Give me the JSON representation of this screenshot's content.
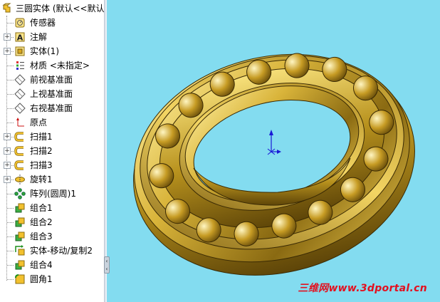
{
  "tree": {
    "root": {
      "label": "三圆实体 (默认<<默认",
      "icon": "part-icon"
    },
    "items": [
      {
        "label": "传感器",
        "icon": "sensor-icon",
        "expandable": false
      },
      {
        "label": "注解",
        "icon": "annotation-icon",
        "expandable": true
      },
      {
        "label": "实体(1)",
        "icon": "solid-bodies-icon",
        "expandable": true
      },
      {
        "label": "材质 <未指定>",
        "icon": "material-icon",
        "expandable": false
      },
      {
        "label": "前视基准面",
        "icon": "plane-icon",
        "expandable": false
      },
      {
        "label": "上视基准面",
        "icon": "plane-icon",
        "expandable": false
      },
      {
        "label": "右视基准面",
        "icon": "plane-icon",
        "expandable": false
      },
      {
        "label": "原点",
        "icon": "origin-icon",
        "expandable": false
      },
      {
        "label": "扫描1",
        "icon": "sweep-icon",
        "expandable": true
      },
      {
        "label": "扫描2",
        "icon": "sweep-icon",
        "expandable": true
      },
      {
        "label": "扫描3",
        "icon": "sweep-icon",
        "expandable": true
      },
      {
        "label": "旋转1",
        "icon": "revolve-icon",
        "expandable": true
      },
      {
        "label": "阵列(圆周)1",
        "icon": "circular-pattern-icon",
        "expandable": false
      },
      {
        "label": "组合1",
        "icon": "combine-icon",
        "expandable": false
      },
      {
        "label": "组合2",
        "icon": "combine-icon",
        "expandable": false
      },
      {
        "label": "组合3",
        "icon": "combine-icon",
        "expandable": false
      },
      {
        "label": "实体-移动/复制2",
        "icon": "move-copy-icon",
        "expandable": false
      },
      {
        "label": "组合4",
        "icon": "combine-icon",
        "expandable": false
      },
      {
        "label": "圆角1",
        "icon": "fillet-icon",
        "expandable": false
      }
    ]
  },
  "viewport": {
    "background": "#83dcf0",
    "model_color": "#c9a52a"
  },
  "watermark": {
    "text": "三维网www.3dportal.cn",
    "color": "#e3101f"
  }
}
